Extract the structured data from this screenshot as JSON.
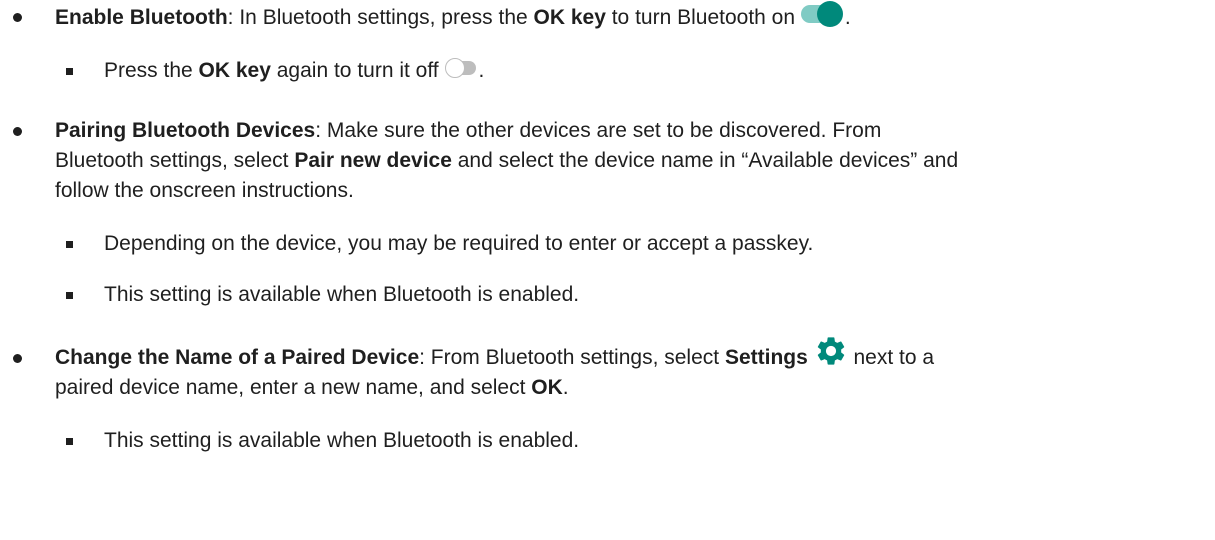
{
  "items": [
    {
      "title": "Enable Bluetooth",
      "text_a": ": In Bluetooth settings, press the ",
      "bold_a": "OK key",
      "text_b": " to turn Bluetooth on ",
      "text_c": ".",
      "icon": "toggle-on-icon",
      "sub": [
        {
          "text_a": "Press the ",
          "bold_a": "OK key",
          "text_b": " again to turn it off ",
          "text_c": ".",
          "icon": "toggle-off-icon"
        }
      ]
    },
    {
      "title": "Pairing Bluetooth Devices",
      "line1": ": Make sure the other devices are set to be discovered. From",
      "line2_a": "Bluetooth settings, select ",
      "line2_bold": "Pair new device",
      "line2_b": " and select the device name in “Available devices” and",
      "line3": "follow the onscreen instructions.",
      "sub": [
        {
          "text": "Depending on the device, you may be required to enter or accept a passkey."
        },
        {
          "text": "This setting is available when Bluetooth is enabled."
        }
      ]
    },
    {
      "title": "Change the Name of a Paired Device",
      "line1_a": ": From Bluetooth settings, select ",
      "line1_bold": "Settings",
      "line1_b": " next to a",
      "line2_a": "paired device name, enter a new name, and select ",
      "line2_bold": "OK",
      "line2_b": ".",
      "icon": "gear-icon",
      "sub": [
        {
          "text": "This setting is available when Bluetooth is enabled."
        }
      ]
    }
  ],
  "colors": {
    "toggle_on": "#00897b",
    "toggle_on_track": "#80cbc4",
    "toggle_off_track": "#bdbdbd",
    "gear": "#00897b"
  }
}
